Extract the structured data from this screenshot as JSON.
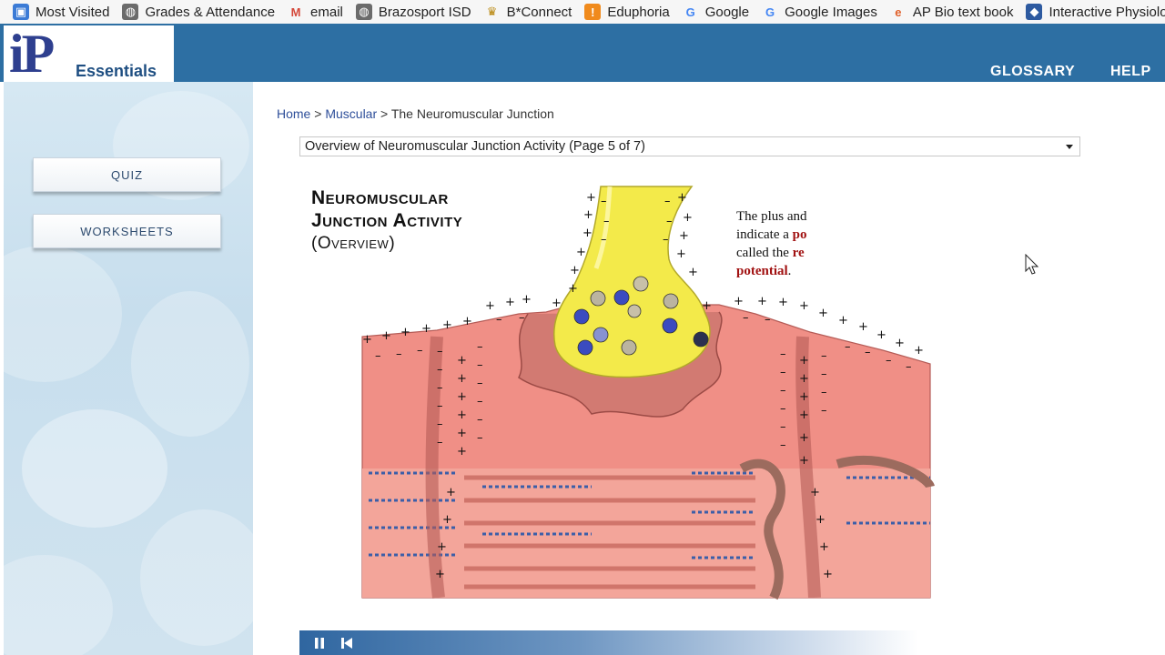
{
  "bookmarks": [
    {
      "label": "Most Visited",
      "icon": "bookmark-folder-icon"
    },
    {
      "label": "Grades & Attendance",
      "icon": "globe-icon"
    },
    {
      "label": "email",
      "icon": "gmail-icon"
    },
    {
      "label": "Brazosport ISD",
      "icon": "globe-icon"
    },
    {
      "label": "B*Connect",
      "icon": "bconnect-icon"
    },
    {
      "label": "Eduphoria",
      "icon": "eduphoria-icon"
    },
    {
      "label": "Google",
      "icon": "google-icon"
    },
    {
      "label": "Google Images",
      "icon": "google-icon"
    },
    {
      "label": "AP Bio text book",
      "icon": "textbook-icon"
    },
    {
      "label": "Interactive Physiology",
      "icon": "ip-shield-icon"
    }
  ],
  "header": {
    "logo_mark": "iP",
    "logo_text": "Essentials",
    "glossary": "GLOSSARY",
    "help": "HELP",
    "bg_color": "#2d6fa3"
  },
  "sidebar": {
    "quiz": "QUIZ",
    "worksheets": "WORKSHEETS"
  },
  "breadcrumb": {
    "home": "Home",
    "sep": ">",
    "section": "Muscular",
    "current": "The Neuromuscular Junction"
  },
  "page_select": {
    "value": "Overview of Neuromuscular Junction Activity (Page 5 of 7)"
  },
  "figure": {
    "title_line1": "Neuromuscular",
    "title_line2": "Junction Activity",
    "title_line3": "(Overview)",
    "caption_1": "The plus and",
    "caption_2": "indicate a ",
    "caption_2_bold": "po",
    "caption_3": "called the ",
    "caption_3_bold": "re",
    "caption_4_bold": "potential",
    "caption_4_end": "."
  },
  "controls": {
    "pause": "pause-icon",
    "rewind": "skip-back-icon"
  }
}
